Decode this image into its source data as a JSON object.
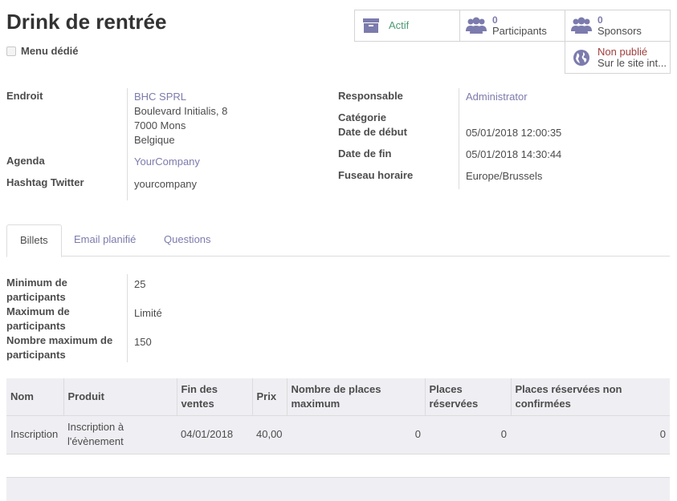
{
  "header": {
    "title": "Drink de rentrée",
    "dedicated_menu_label": "Menu dédié"
  },
  "smart_buttons": {
    "active": {
      "label": "Actif"
    },
    "participants": {
      "count": "0",
      "label": "Participants"
    },
    "sponsors": {
      "count": "0",
      "label": "Sponsors"
    },
    "website": {
      "status": "Non publié",
      "label": "Sur le site int..."
    }
  },
  "colors": {
    "accent": "#7c7bad",
    "unpublished": "#a0403c"
  },
  "left_fields": {
    "location_label": "Endroit",
    "location_name": "BHC SPRL",
    "location_line1": "Boulevard Initialis, 8",
    "location_line2": "7000 Mons",
    "location_line3": "Belgique",
    "agenda_label": "Agenda",
    "agenda_value": "YourCompany",
    "hashtag_label": "Hashtag Twitter",
    "hashtag_value": "yourcompany"
  },
  "right_fields": {
    "responsible_label": "Responsable",
    "responsible_value": "Administrator",
    "category_label": "Catégorie",
    "start_label": "Date de début",
    "start_value": "05/01/2018 12:00:35",
    "end_label": "Date de fin",
    "end_value": "05/01/2018 14:30:44",
    "timezone_label": "Fuseau horaire",
    "timezone_value": "Europe/Brussels"
  },
  "tabs": [
    "Billets",
    "Email planifié",
    "Questions"
  ],
  "tickets_fields": {
    "min_label_1": "Minimum de",
    "min_label_2": "participants",
    "min_value": "25",
    "max_label_1": "Maximum de",
    "max_label_2": "participants",
    "max_value": "Limité",
    "maxnum_label_1": "Nombre maximum de",
    "maxnum_label_2": "participants",
    "maxnum_value": "150"
  },
  "table": {
    "headers": {
      "name": "Nom",
      "product": "Produit",
      "end_sale_1": "Fin des",
      "end_sale_2": "ventes",
      "price": "Prix",
      "max_seats_1": "Nombre de places",
      "max_seats_2": "maximum",
      "reserved_1": "Places",
      "reserved_2": "réservées",
      "unconfirmed_1": "Places réservées non",
      "unconfirmed_2": "confirmées"
    },
    "rows": [
      {
        "name": "Inscription",
        "product_1": "Inscription à",
        "product_2": "l'évènement",
        "end_sale": "04/01/2018",
        "price": "40,00",
        "max_seats": "0",
        "reserved": "0",
        "unconfirmed": "0"
      }
    ]
  }
}
